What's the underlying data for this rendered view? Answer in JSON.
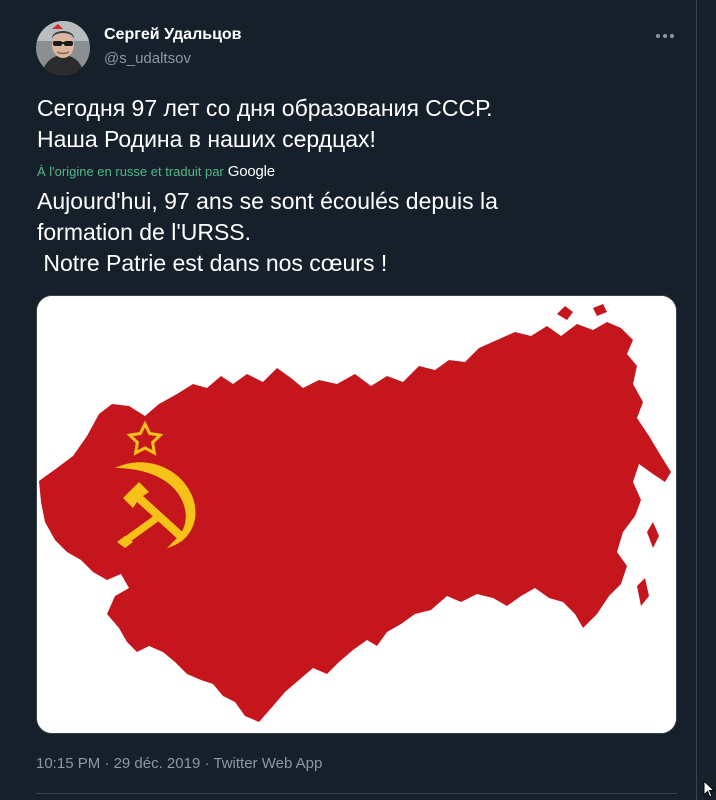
{
  "author": {
    "display_name": "Сергей Удальцов",
    "handle": "@s_udaltsov"
  },
  "tweet": {
    "original_lines": [
      "Сегодня 97 лет со дня образования СССР.",
      "Наша Родина в наших сердцах!"
    ],
    "translation_label": "À l'origine en russe et traduit par",
    "translation_provider": "Google",
    "translation_lines": [
      "Aujourd'hui, 97 ans se sont écoulés depuis la",
      "formation de l'URSS.",
      " Notre Patrie est dans nos cœurs !"
    ]
  },
  "meta": {
    "time": "10:15 PM",
    "separator": " · ",
    "date": "29 déc. 2019",
    "source": "Twitter Web App"
  },
  "icons": {
    "more": "more-horizontal-icon",
    "cursor": "mouse-pointer-icon"
  },
  "colors": {
    "background": "#15202b",
    "text": "#ffffff",
    "secondary_text": "#8b98a5",
    "border": "#38444d",
    "translation_label": "#52b788",
    "map_red": "#c4161c",
    "emblem_yellow": "#f6c21a"
  }
}
